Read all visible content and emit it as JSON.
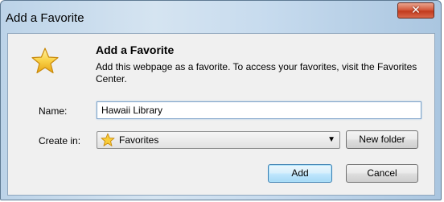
{
  "window": {
    "title": "Add a Favorite",
    "close_glyph": "✕"
  },
  "dialog": {
    "heading": "Add a Favorite",
    "description": "Add this webpage as a favorite. To access your favorites, visit the Favorites Center.",
    "icon": "star-icon"
  },
  "form": {
    "name_label": "Name:",
    "name_value": "Hawaii Library",
    "create_in_label": "Create in:",
    "create_in_value": "Favorites",
    "create_in_icon": "star-folder-icon"
  },
  "buttons": {
    "new_folder": "New folder",
    "add": "Add",
    "cancel": "Cancel"
  },
  "colors": {
    "title_gradient_start": "#bcd3e8",
    "close_red": "#c23a1d",
    "star_gold": "#f6c230"
  }
}
